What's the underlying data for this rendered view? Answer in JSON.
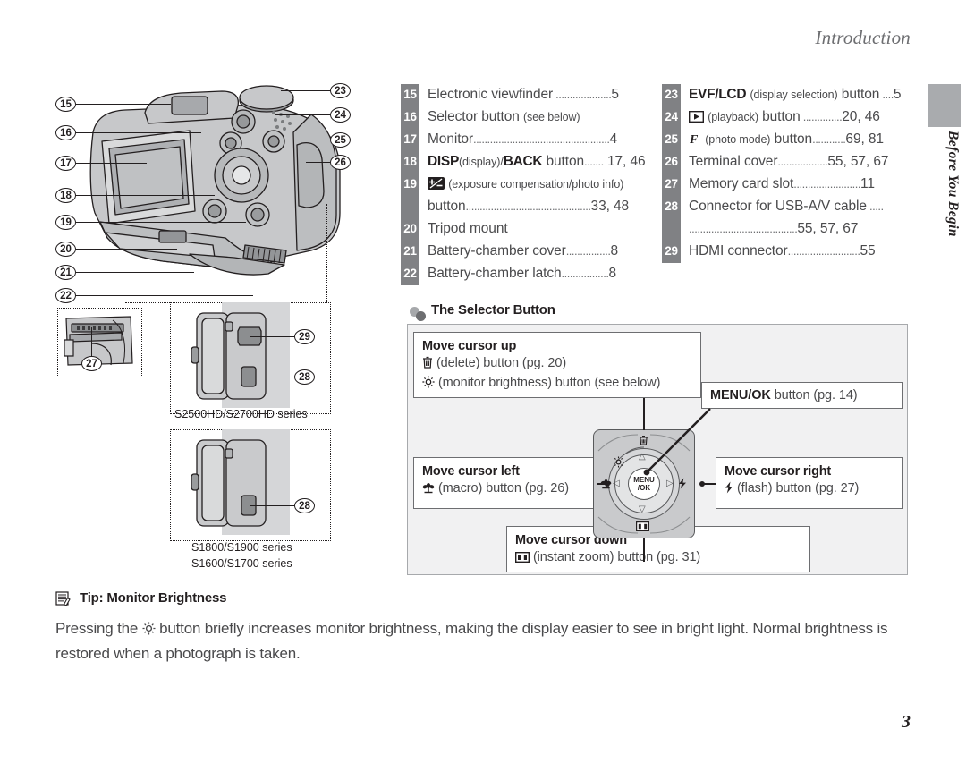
{
  "header": {
    "running_head": "Introduction"
  },
  "side_tab": {
    "label": "Before You Begin"
  },
  "page_number": "3",
  "illustration": {
    "callouts_left": [
      "15",
      "16",
      "17",
      "18",
      "19",
      "20",
      "21",
      "22"
    ],
    "callouts_right": [
      "23",
      "24",
      "25",
      "26"
    ],
    "callout_card_slot": "27",
    "callout_hdmi": "29",
    "callout_usb_top": "28",
    "callout_usb_bottom": "28",
    "series_label_top": "S2500HD/S2700HD series",
    "series_label_bottom_1": "S1800/S1900 series",
    "series_label_bottom_2": "S1600/S1700 series"
  },
  "parts_list_left": [
    {
      "num": "15",
      "text": "Electronic viewfinder",
      "dots": true,
      "page": "5"
    },
    {
      "num": "16",
      "text": "Selector button",
      "note": "(see below)",
      "dots": false,
      "page": ""
    },
    {
      "num": "17",
      "text": "Monitor",
      "dots": true,
      "page": "4"
    },
    {
      "num": "18",
      "bold_a": "DISP",
      "note_a": "(display)/",
      "bold_b": "BACK",
      "text": " button",
      "dots": true,
      "page": "17, 46"
    },
    {
      "num": "19",
      "icon": "exposure-compensation-icon",
      "note": "(exposure compensation/photo info)",
      "dots": false,
      "page": ""
    },
    {
      "num": "",
      "text": "button",
      "dots": true,
      "page": "33, 48"
    },
    {
      "num": "20",
      "text": "Tripod mount",
      "dots": false,
      "page": ""
    },
    {
      "num": "21",
      "text": "Battery-chamber cover",
      "dots": true,
      "page": "8"
    },
    {
      "num": "22",
      "text": "Battery-chamber latch",
      "dots": true,
      "page": "8"
    }
  ],
  "parts_list_right": [
    {
      "num": "23",
      "bold_a": "EVF/LCD",
      "note": "(display selection)",
      "text": " button",
      "dots": true,
      "page": "5"
    },
    {
      "num": "24",
      "icon": "playback-icon",
      "note": "(playback)",
      "text": " button",
      "dots": true,
      "page": "20, 46"
    },
    {
      "num": "25",
      "icon": "photo-mode-icon",
      "note": "(photo mode)",
      "text": " button",
      "dots": true,
      "page": "69, 81"
    },
    {
      "num": "26",
      "text": "Terminal cover",
      "dots": true,
      "page": "55, 57, 67"
    },
    {
      "num": "27",
      "text": "Memory card slot",
      "dots": true,
      "page": "11"
    },
    {
      "num": "28",
      "text": "Connector for USB-A/V cable",
      "dots": true,
      "page": ""
    },
    {
      "num": "",
      "text": "",
      "dots": true,
      "page": "55, 57, 67"
    },
    {
      "num": "29",
      "text": "HDMI connector",
      "dots": true,
      "page": "55"
    }
  ],
  "selector_panel": {
    "heading": "The Selector Button",
    "up": {
      "title": "Move cursor up",
      "line1_icon": "delete-trash-icon",
      "line1": "(delete) button (pg. 20)",
      "line2_icon": "monitor-brightness-sun-icon",
      "line2": "(monitor brightness) button (see below)"
    },
    "left": {
      "title": "Move cursor left",
      "icon": "macro-flower-icon",
      "line": "(macro) button (pg. 26)"
    },
    "right": {
      "title": "Move cursor right",
      "icon": "flash-bolt-icon",
      "line": "(flash) button (pg. 27)"
    },
    "down": {
      "title": "Move cursor down",
      "icon": "instant-zoom-icon",
      "line": "(instant zoom) button (pg. 31)"
    },
    "menu_ok": {
      "bold": "MENU/OK",
      "line": " button (pg. 14)"
    },
    "pad_center_line1": "MENU",
    "pad_center_line2": "/OK"
  },
  "tip": {
    "heading": "Tip: Monitor Brightness",
    "body_part1": "Pressing the ",
    "body_icon": "monitor-brightness-sun-icon",
    "body_part2": " button briefly increases monitor brightness, making the display easier to see in bright light.  Normal brightness is restored when a photograph is taken."
  },
  "colors": {
    "rail_gray": "#808184",
    "panel_gray": "#f1f1f2",
    "tab_gray": "#a9abae",
    "text_gray": "#4a4a4c",
    "ink": "#231f20"
  }
}
